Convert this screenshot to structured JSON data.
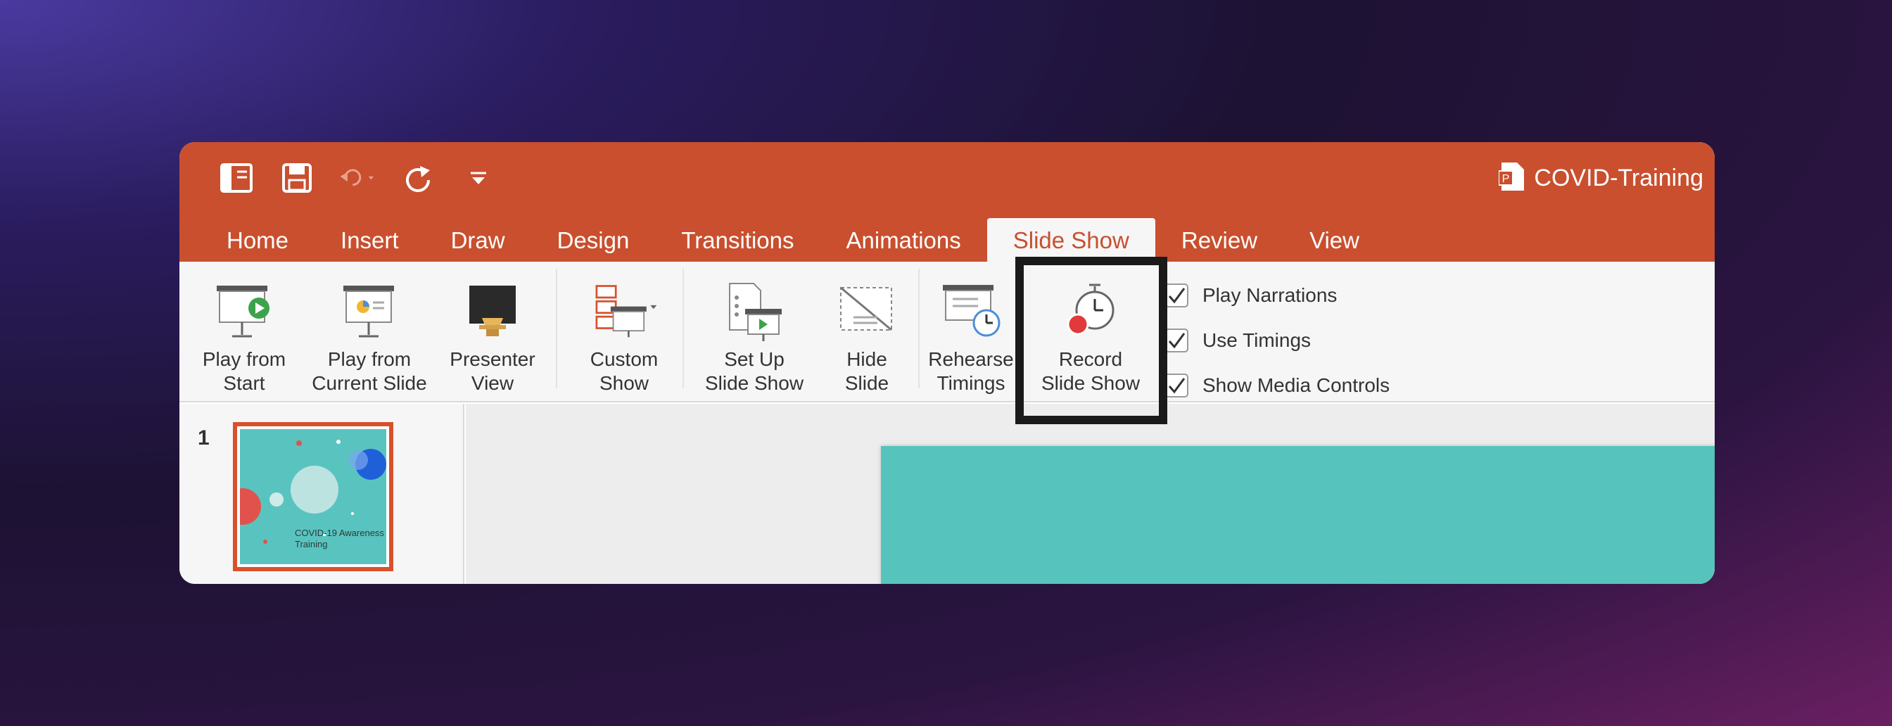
{
  "window": {
    "doc_title": "COVID-Training",
    "accent": "#c94f2e"
  },
  "quick_access": [
    "sidebar-icon",
    "save-icon",
    "undo-icon",
    "redo-icon",
    "customize-icon"
  ],
  "tabs": [
    {
      "label": "Home"
    },
    {
      "label": "Insert"
    },
    {
      "label": "Draw"
    },
    {
      "label": "Design"
    },
    {
      "label": "Transitions"
    },
    {
      "label": "Animations"
    },
    {
      "label": "Slide Show"
    },
    {
      "label": "Review"
    },
    {
      "label": "View"
    }
  ],
  "ribbon": {
    "buttons": [
      {
        "label": "Play from\nStart"
      },
      {
        "label": "Play from\nCurrent Slide"
      },
      {
        "label": "Presenter\nView"
      },
      {
        "label": "Custom\nShow"
      },
      {
        "label": "Set Up\nSlide Show"
      },
      {
        "label": "Hide\nSlide"
      },
      {
        "label": "Rehearse\nTimings"
      },
      {
        "label": "Record\nSlide Show"
      }
    ],
    "checkboxes": [
      {
        "label": "Play Narrations",
        "checked": true
      },
      {
        "label": "Use Timings",
        "checked": true
      },
      {
        "label": "Show Media Controls",
        "checked": true
      }
    ]
  },
  "slides_panel": {
    "slide_number": "1",
    "thumbnail_caption": "COVID-19 Awareness Training"
  }
}
